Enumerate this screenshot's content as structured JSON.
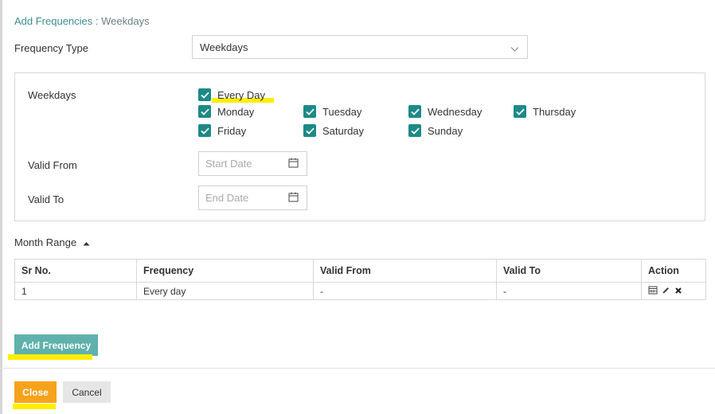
{
  "header": {
    "link": "Add Frequencies",
    "separator": " : ",
    "current": "Weekdays"
  },
  "frequency_type": {
    "label": "Frequency Type",
    "value": "Weekdays"
  },
  "weekdays": {
    "label": "Weekdays",
    "every_day": {
      "label": "Every Day",
      "checked": true
    },
    "days": [
      {
        "label": "Monday",
        "checked": true
      },
      {
        "label": "Tuesday",
        "checked": true
      },
      {
        "label": "Wednesday",
        "checked": true
      },
      {
        "label": "Thursday",
        "checked": true
      },
      {
        "label": "Friday",
        "checked": true
      },
      {
        "label": "Saturday",
        "checked": true
      },
      {
        "label": "Sunday",
        "checked": true
      }
    ]
  },
  "valid_from": {
    "label": "Valid From",
    "placeholder": "Start Date"
  },
  "valid_to": {
    "label": "Valid To",
    "placeholder": "End Date"
  },
  "month_range": {
    "label": "Month Range"
  },
  "table": {
    "headers": [
      "Sr No.",
      "Frequency",
      "Valid From",
      "Valid To",
      "Action"
    ],
    "rows": [
      {
        "sr": "1",
        "frequency": "Every day",
        "valid_from": "-",
        "valid_to": "-"
      }
    ]
  },
  "buttons": {
    "add_frequency": "Add Frequency",
    "close": "Close",
    "cancel": "Cancel"
  },
  "colors": {
    "accent_teal": "#1c8a88",
    "add_button": "#5fb1ad",
    "close_button": "#f7a21b",
    "highlight": "#ffee00"
  },
  "icons": [
    "chevron-down-icon",
    "check-icon",
    "calendar-icon",
    "caret-up-icon",
    "pencil-icon",
    "close-icon"
  ]
}
